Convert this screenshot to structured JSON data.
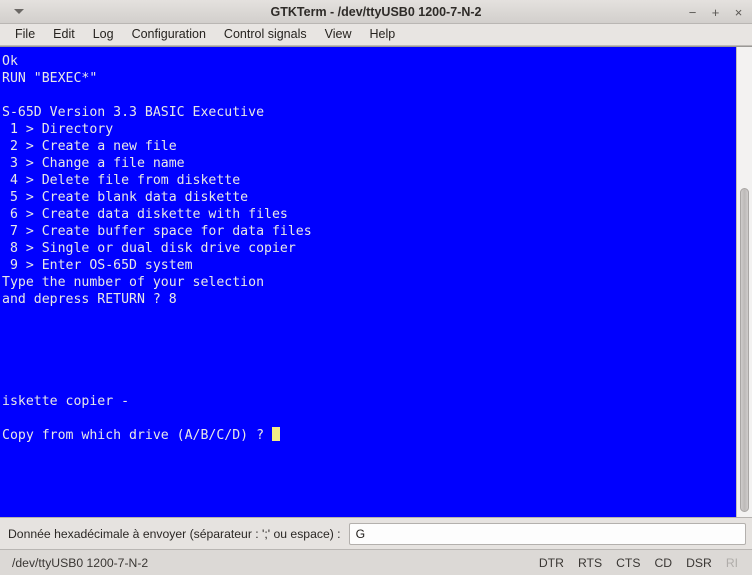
{
  "window": {
    "title": "GTKTerm - /dev/ttyUSB0  1200-7-N-2",
    "menu_arrow_icon": "chevron-down-icon",
    "buttons": {
      "minimize": "−",
      "maximize": "+",
      "close": "×"
    }
  },
  "menubar": {
    "items": [
      {
        "label": "File"
      },
      {
        "label": "Edit"
      },
      {
        "label": "Log"
      },
      {
        "label": "Configuration"
      },
      {
        "label": "Control signals"
      },
      {
        "label": "View"
      },
      {
        "label": "Help"
      }
    ]
  },
  "terminal": {
    "background_color": "#0000ff",
    "text_color": "#e8e8e8",
    "cursor_color": "#f2eb86",
    "lines": [
      "Ok",
      "RUN \"BEXEC*\"",
      "",
      "S-65D Version 3.3 BASIC Executive",
      " 1 > Directory",
      " 2 > Create a new file",
      " 3 > Change a file name",
      " 4 > Delete file from diskette",
      " 5 > Create blank data diskette",
      " 6 > Create data diskette with files",
      " 7 > Create buffer space for data files",
      " 8 > Single or dual disk drive copier",
      " 9 > Enter OS-65D system",
      "Type the number of your selection",
      "and depress RETURN ? 8",
      "",
      "",
      "",
      "",
      "",
      "iskette copier -",
      "",
      "Copy from which drive (A/B/C/D) ? "
    ],
    "cursor_line_index": 22
  },
  "scrollbar": {
    "thumb_top_pct": 30,
    "thumb_height_pct": 69
  },
  "sendbar": {
    "label": "Donnée hexadécimale à envoyer (séparateur : ';' ou espace) :",
    "input_value": "G",
    "input_placeholder": ""
  },
  "statusbar": {
    "port_info": "/dev/ttyUSB0  1200-7-N-2",
    "signals": [
      {
        "label": "DTR",
        "active": true
      },
      {
        "label": "RTS",
        "active": true
      },
      {
        "label": "CTS",
        "active": true
      },
      {
        "label": "CD",
        "active": true
      },
      {
        "label": "DSR",
        "active": true
      },
      {
        "label": "RI",
        "active": false
      }
    ]
  }
}
